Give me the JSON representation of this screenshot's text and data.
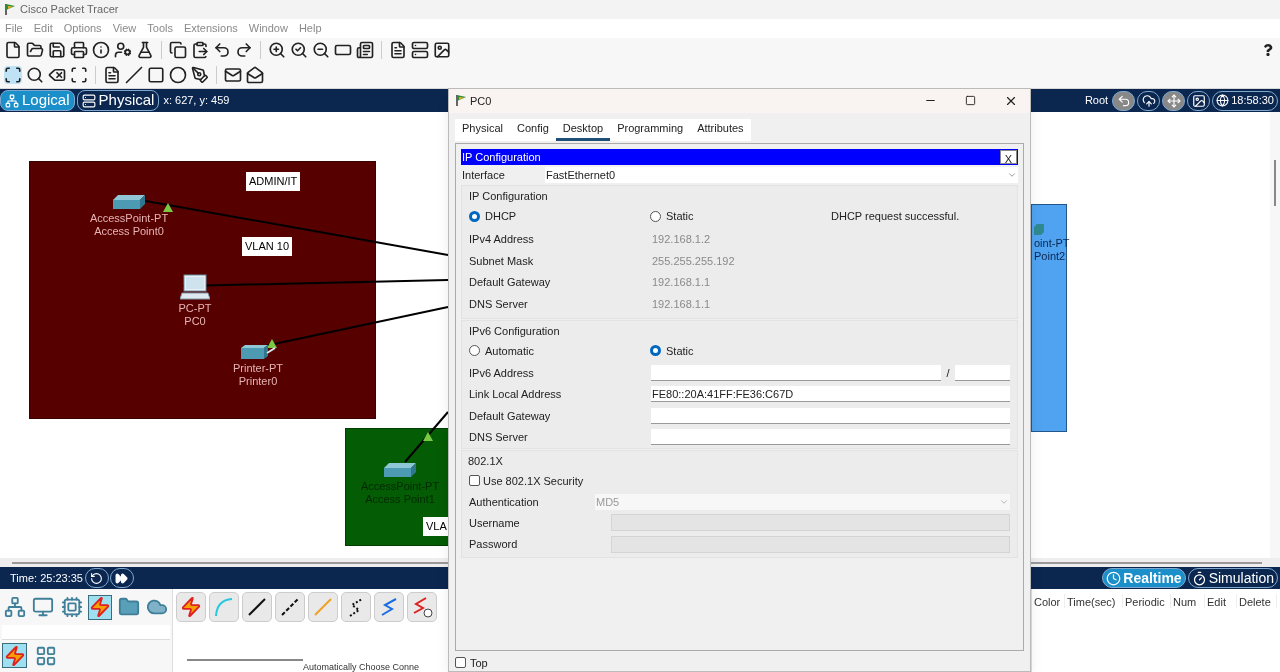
{
  "window": {
    "title": "Cisco Packet Tracer"
  },
  "menu": [
    "File",
    "Edit",
    "Options",
    "View",
    "Tools",
    "Extensions",
    "Window",
    "Help"
  ],
  "workspace_bar": {
    "tabs": [
      {
        "label": "Logical",
        "selected": true
      },
      {
        "label": "Physical",
        "selected": false
      }
    ],
    "coordinates": "x: 627, y: 459",
    "root_label": "Root",
    "clock": "18:58:30"
  },
  "canvas": {
    "areas": [
      {
        "color": "#560000"
      },
      {
        "color": "#045c04"
      },
      {
        "color": "#4fa3f0"
      }
    ],
    "notes": [
      "ADMIN/IT",
      "VLAN 10",
      "VLA"
    ],
    "devices": [
      {
        "kind": "access-point",
        "model": "AccessPoint-PT",
        "name": "Access Point0"
      },
      {
        "kind": "pc",
        "model": "PC-PT",
        "name": "PC0"
      },
      {
        "kind": "printer",
        "model": "Printer-PT",
        "name": "Printer0"
      },
      {
        "kind": "access-point",
        "model": "AccessPoint-PT",
        "name": "Access Point1"
      },
      {
        "kind": "access-point",
        "model": "oint-PT",
        "name": "Point2"
      }
    ]
  },
  "sim_bar": {
    "time": "Time: 25:23:35",
    "modes": [
      {
        "label": "Realtime",
        "selected": true
      },
      {
        "label": "Simulation",
        "selected": false
      }
    ]
  },
  "device_types": [
    {
      "kind": "network-devices",
      "selected": false
    },
    {
      "kind": "end-devices",
      "selected": false
    },
    {
      "kind": "components",
      "selected": false
    },
    {
      "kind": "connections",
      "selected": true
    },
    {
      "kind": "miscellaneous",
      "selected": false
    },
    {
      "kind": "multiuser",
      "selected": false
    }
  ],
  "device_subtypes": [
    {
      "kind": "connections",
      "selected": true
    },
    {
      "kind": "grid",
      "selected": false
    }
  ],
  "cables": [
    {
      "kind": "auto"
    },
    {
      "kind": "console"
    },
    {
      "kind": "straight"
    },
    {
      "kind": "crossover"
    },
    {
      "kind": "fiber"
    },
    {
      "kind": "phone"
    },
    {
      "kind": "coaxial"
    },
    {
      "kind": "serial"
    }
  ],
  "cable_hint": "Automatically Choose Conne",
  "event_list": {
    "columns": [
      "Color",
      "Time(sec)",
      "Periodic",
      "Num",
      "Edit",
      "Delete"
    ]
  },
  "dialog": {
    "title": "PC0",
    "tabs": [
      {
        "label": "Physical",
        "selected": false
      },
      {
        "label": "Config",
        "selected": false
      },
      {
        "label": "Desktop",
        "selected": true
      },
      {
        "label": "Programming",
        "selected": false
      },
      {
        "label": "Attributes",
        "selected": false
      }
    ],
    "panel_title": "IP Configuration",
    "panel_close": "X",
    "interface_label": "Interface",
    "interface": "FastEthernet0",
    "ipv4": {
      "title": "IP Configuration",
      "modes": [
        {
          "label": "DHCP",
          "selected": true
        },
        {
          "label": "Static",
          "selected": false
        }
      ],
      "status": "DHCP request successful.",
      "fields": [
        {
          "label": "IPv4 Address",
          "value": "192.168.1.2",
          "disabled": true
        },
        {
          "label": "Subnet Mask",
          "value": "255.255.255.192",
          "disabled": true
        },
        {
          "label": "Default Gateway",
          "value": "192.168.1.1",
          "disabled": true
        },
        {
          "label": "DNS Server",
          "value": "192.168.1.1",
          "disabled": true
        }
      ]
    },
    "ipv6": {
      "title": "IPv6 Configuration",
      "modes": [
        {
          "label": "Automatic",
          "selected": false
        },
        {
          "label": "Static",
          "selected": true
        }
      ],
      "address_label": "IPv6 Address",
      "separator": "/",
      "fields": [
        {
          "label": "Link Local Address",
          "value": "FE80::20A:41FF:FE36:C67D"
        },
        {
          "label": "Default Gateway"
        },
        {
          "label": "DNS Server"
        }
      ]
    },
    "dot1x": {
      "title": "802.1X",
      "use_security": {
        "label": "Use 802.1X Security",
        "checked": false
      },
      "auth_label": "Authentication",
      "auth_value": "MD5",
      "username_label": "Username",
      "password_label": "Password"
    },
    "top": {
      "label": "Top",
      "checked": false
    }
  }
}
